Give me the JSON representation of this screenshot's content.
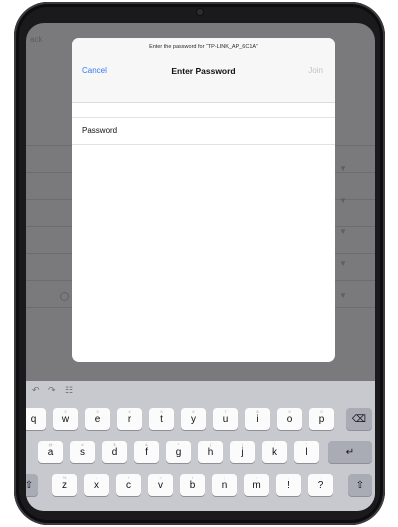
{
  "background": {
    "back_label": "ack"
  },
  "modal": {
    "prompt": "Enter the password for “TP-LINK_AP_6C1A”",
    "cancel_label": "Cancel",
    "title": "Enter Password",
    "join_label": "Join",
    "field_label": "Password",
    "field_value": ""
  },
  "keyboard": {
    "toolbar": [
      "undo-icon",
      "redo-icon",
      "paste-icon"
    ],
    "row1": [
      {
        "k": "q",
        "h": ""
      },
      {
        "k": "w",
        "h": "2"
      },
      {
        "k": "e",
        "h": "3"
      },
      {
        "k": "r",
        "h": "4"
      },
      {
        "k": "t",
        "h": "5"
      },
      {
        "k": "y",
        "h": "6"
      },
      {
        "k": "u",
        "h": "7"
      },
      {
        "k": "i",
        "h": "8"
      },
      {
        "k": "o",
        "h": "9"
      },
      {
        "k": "p",
        "h": "0"
      }
    ],
    "row2": [
      {
        "k": "a",
        "h": "@"
      },
      {
        "k": "s",
        "h": "#"
      },
      {
        "k": "d",
        "h": "$"
      },
      {
        "k": "f",
        "h": "&"
      },
      {
        "k": "g",
        "h": "*"
      },
      {
        "k": "h",
        "h": "("
      },
      {
        "k": "j",
        "h": ")"
      },
      {
        "k": "k",
        "h": "'"
      },
      {
        "k": "l",
        "h": "\""
      }
    ],
    "row3": [
      {
        "k": "z",
        "h": "%"
      },
      {
        "k": "x",
        "h": "-"
      },
      {
        "k": "c",
        "h": "+"
      },
      {
        "k": "v",
        "h": "="
      },
      {
        "k": "b",
        "h": "/"
      },
      {
        "k": "n",
        "h": ";"
      },
      {
        "k": "m",
        "h": ":"
      },
      {
        "k": "!",
        "h": ","
      },
      {
        "k": "?",
        "h": "."
      }
    ]
  },
  "colors": {
    "accent": "#3478f6",
    "disabled": "#c4c4c6",
    "keyboard_bg": "#c7c9ce"
  }
}
